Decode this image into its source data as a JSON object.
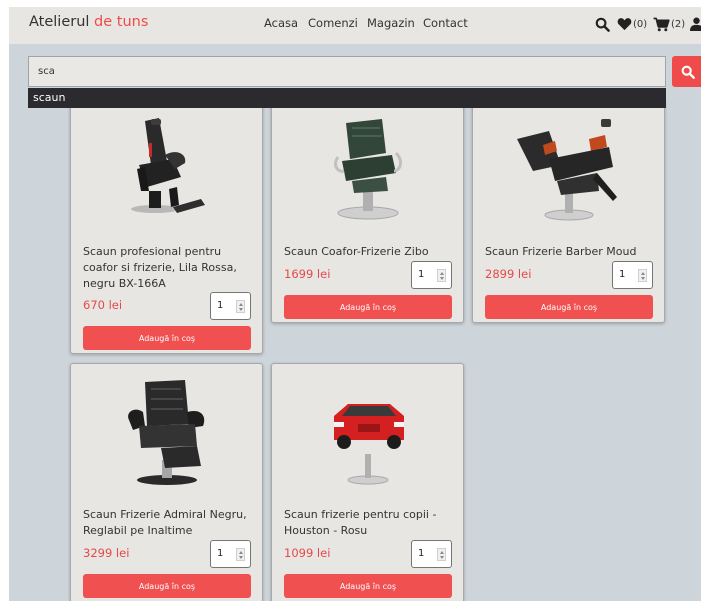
{
  "navbar": {
    "brand_main": "Atelierul",
    "brand_accent": "de tuns",
    "links": [
      {
        "label": "Acasa"
      },
      {
        "label": "Comenzi"
      },
      {
        "label": "Magazin"
      },
      {
        "label": "Contact"
      }
    ],
    "favorites_count": "(0)",
    "cart_count": "(2)"
  },
  "search": {
    "value": "sca",
    "suggestion": "scaun"
  },
  "colors": {
    "accent": "#ef4b4b",
    "price": "#e54848",
    "page_background": "#ced5da",
    "card_background": "#e8e6e2"
  },
  "products": [
    {
      "title": "Scaun profesional pentru coafor si frizerie, Lila Rossa, negru BX-166A",
      "price": "670 lei",
      "quantity": "1",
      "add_label": "Adaugă în coş",
      "image": "black-hydraulic-chair"
    },
    {
      "title": "Scaun Coafor-Frizerie Zibo",
      "price": "1699 lei",
      "quantity": "1",
      "add_label": "Adaugă în coş",
      "image": "green-salon-chair"
    },
    {
      "title": "Scaun Frizerie Barber Moud",
      "price": "2899 lei",
      "quantity": "1",
      "add_label": "Adaugă în coş",
      "image": "reclining-barber-chair"
    },
    {
      "title": "Scaun Frizerie Admiral Negru, Reglabil pe Inaltime",
      "price": "3299 lei",
      "quantity": "1",
      "add_label": "Adaugă în coş",
      "image": "quilted-barber-chair"
    },
    {
      "title": "Scaun frizerie pentru copii - Houston - Rosu",
      "price": "1099 lei",
      "quantity": "1",
      "add_label": "Adaugă în coş",
      "image": "kids-car-chair"
    }
  ]
}
